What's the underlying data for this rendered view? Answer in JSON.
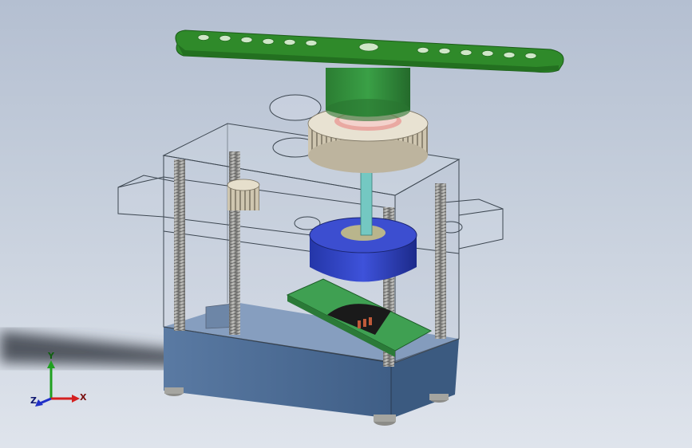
{
  "viewport": {
    "background_top": "#b4bfd1",
    "background_bottom": "#dfe4ec"
  },
  "model": {
    "servo_arm_color": "#2f8a2a",
    "output_shaft_color": "#2d8a38",
    "gear_color": "#d9d1be",
    "motor_color": "#2f3fc4",
    "pcb_color": "#3fa052",
    "base_color": "#4f6f98",
    "screw_color": "#9a9a98",
    "spindle_color": "#74c8c2"
  },
  "triad": {
    "x_label": "X",
    "y_label": "Y",
    "z_label": "Z",
    "x_color": "#d42020",
    "y_color": "#20a020",
    "z_color": "#2030c8"
  }
}
